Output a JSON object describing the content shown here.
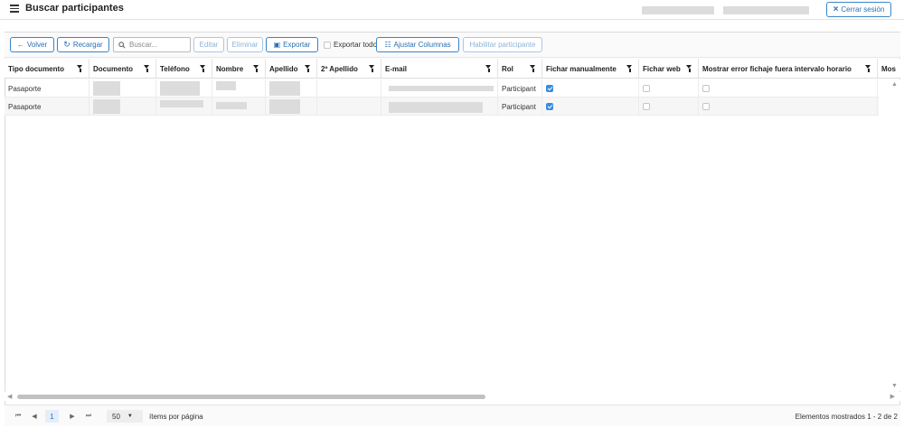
{
  "header": {
    "title": "Buscar participantes",
    "logout_label": "Cerrar sesión"
  },
  "toolbar": {
    "back_label": "Volver",
    "reload_label": "Recargar",
    "search_placeholder": "Buscar...",
    "edit_label": "Editar",
    "delete_label": "Eliminar",
    "export_label": "Exportar",
    "export_all_label": "Exportar todo",
    "adjust_columns_label": "Ajustar Columnas",
    "enable_participant_label": "Habilitar participante"
  },
  "columns": {
    "tipo_documento": "Tipo documento",
    "documento": "Documento",
    "telefono": "Teléfono",
    "nombre": "Nombre",
    "apellido": "Apellido",
    "apellido2": "2º Apellido",
    "email": "E-mail",
    "rol": "Rol",
    "fichar_manual": "Fichar manualmente",
    "fichar_web": "Fichar web",
    "mostrar_error": "Mostrar error fichaje fuera intervalo horario",
    "mos": "Mos"
  },
  "rows": [
    {
      "tipo_documento": "Pasaporte",
      "rol": "Participant",
      "fichar_manual": true,
      "fichar_web": false,
      "mostrar_error": false,
      "mos": false
    },
    {
      "tipo_documento": "Pasaporte",
      "rol": "Participant",
      "fichar_manual": true,
      "fichar_web": false,
      "mostrar_error": false,
      "mos": false
    }
  ],
  "pager": {
    "current_page": "1",
    "page_size": "50",
    "per_page_label": "ítems por página",
    "showing_label": "Elementos mostrados 1 - 2 de 2"
  },
  "icons": {
    "first": "first-page-icon",
    "prev": "prev-page-icon",
    "next": "next-page-icon",
    "last": "last-page-icon"
  }
}
